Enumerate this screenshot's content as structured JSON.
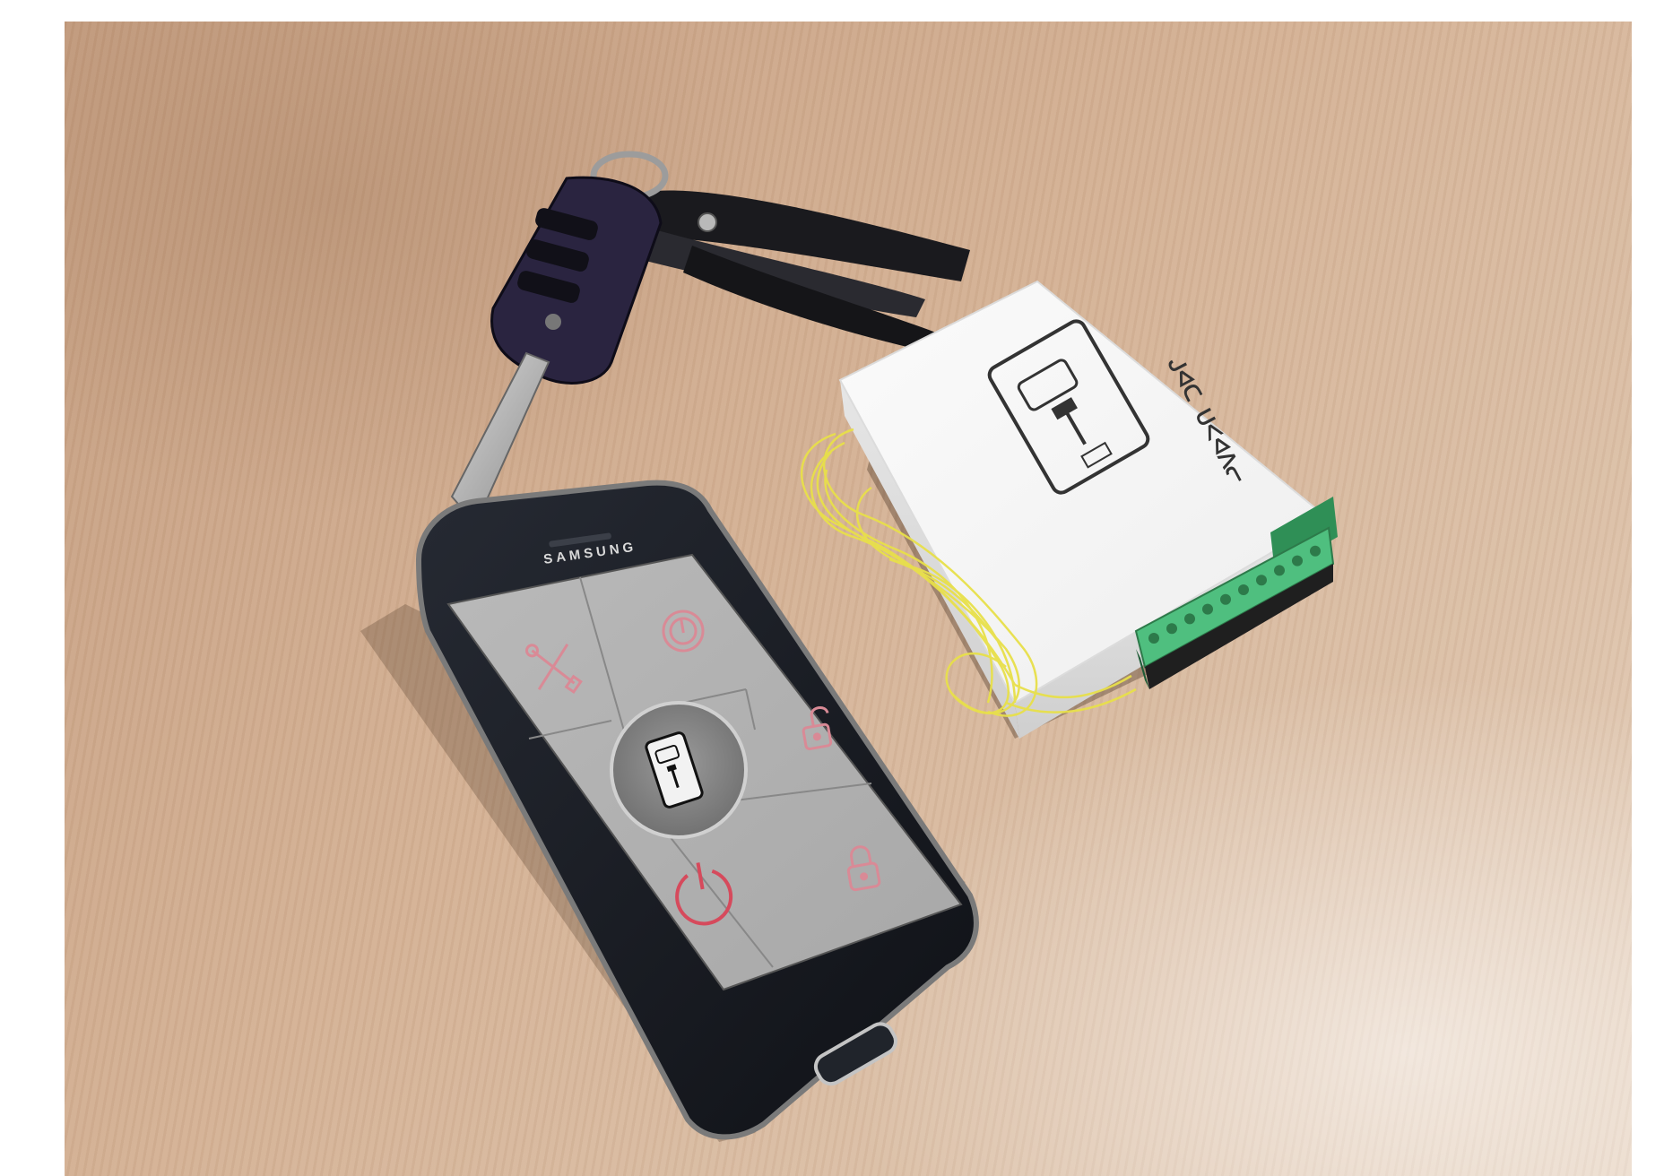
{
  "scene": {
    "phone": {
      "brand": "SAMSUNG",
      "screen_tiles": [
        {
          "icon": "wrench-screwdriver-icon",
          "color": "#d98a96"
        },
        {
          "icon": "power-icon",
          "color": "#d98a96"
        },
        {
          "icon": "unlock-icon",
          "color": "#d98a96"
        },
        {
          "icon": "power-icon",
          "color": "#d64a5c"
        },
        {
          "icon": "lock-icon",
          "color": "#d98a96"
        }
      ],
      "center_logo": "phone-car-key-icon"
    },
    "module": {
      "label": "ᒍᐊᑕ ᑌᐸᐊᐱᓕ",
      "logo": "phone-car-key-icon",
      "terminal_color": "#4fbf7f",
      "wire_color": "#e8e04a"
    },
    "key": {
      "fob_color": "#2a2440",
      "buttons": 3
    }
  }
}
